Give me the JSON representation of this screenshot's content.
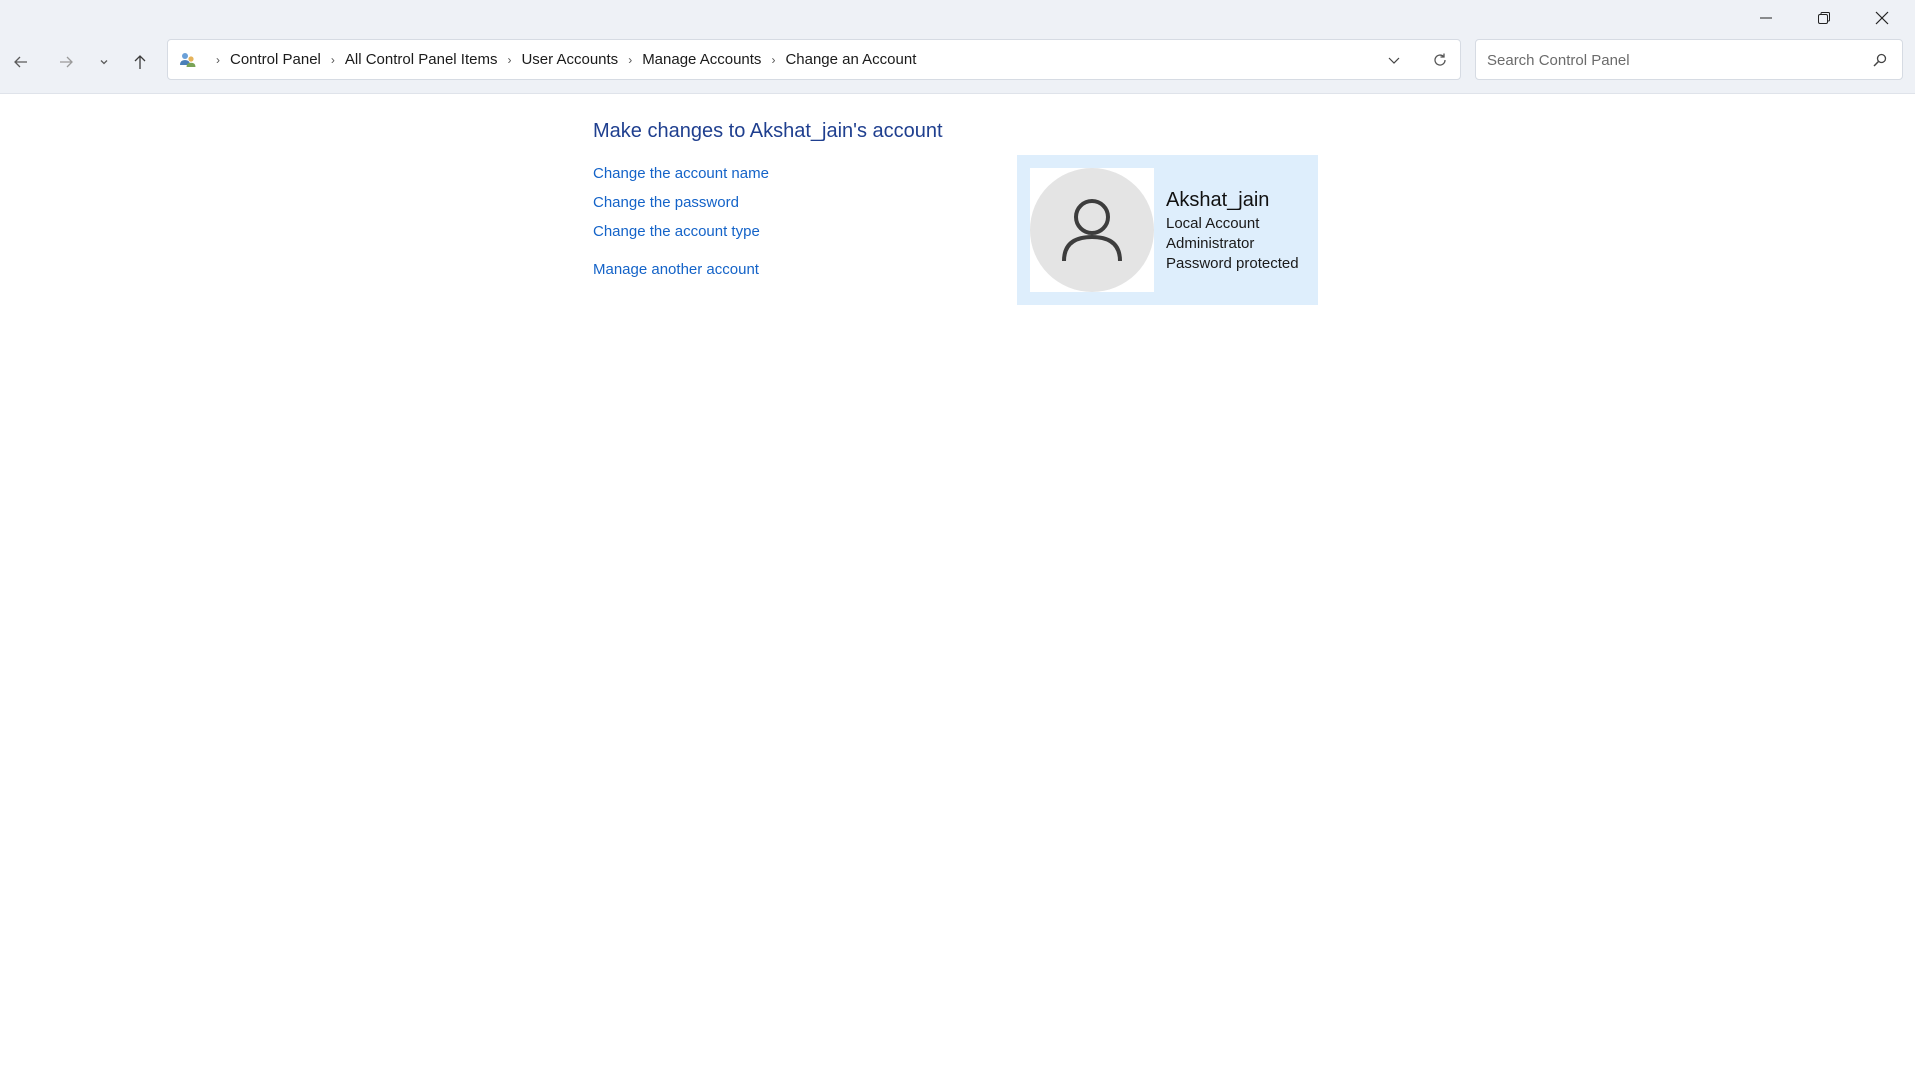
{
  "window": {
    "minimize_icon": "minimize-icon",
    "maximize_icon": "restore-icon",
    "close_icon": "close-icon"
  },
  "nav": {
    "back_icon": "arrow-left-icon",
    "forward_icon": "arrow-right-icon",
    "recent_icon": "chevron-down-icon",
    "up_icon": "arrow-up-icon"
  },
  "breadcrumb": {
    "icon": "control-panel-users-icon",
    "items": [
      "Control Panel",
      "All Control Panel Items",
      "User Accounts",
      "Manage Accounts",
      "Change an Account"
    ]
  },
  "search": {
    "placeholder": "Search Control Panel",
    "value": ""
  },
  "main": {
    "title": "Make changes to Akshat_jain's account",
    "links": [
      "Change the account name",
      "Change the password",
      "Change the account type",
      "Manage another account"
    ]
  },
  "account": {
    "name": "Akshat_jain",
    "type": "Local Account",
    "role": "Administrator",
    "status": "Password protected",
    "avatar_icon": "user-avatar-icon"
  },
  "colors": {
    "link": "#1463c8",
    "title": "#1f3f8f",
    "card_bg": "#deeefc",
    "chrome_bg": "#eef1f6"
  }
}
